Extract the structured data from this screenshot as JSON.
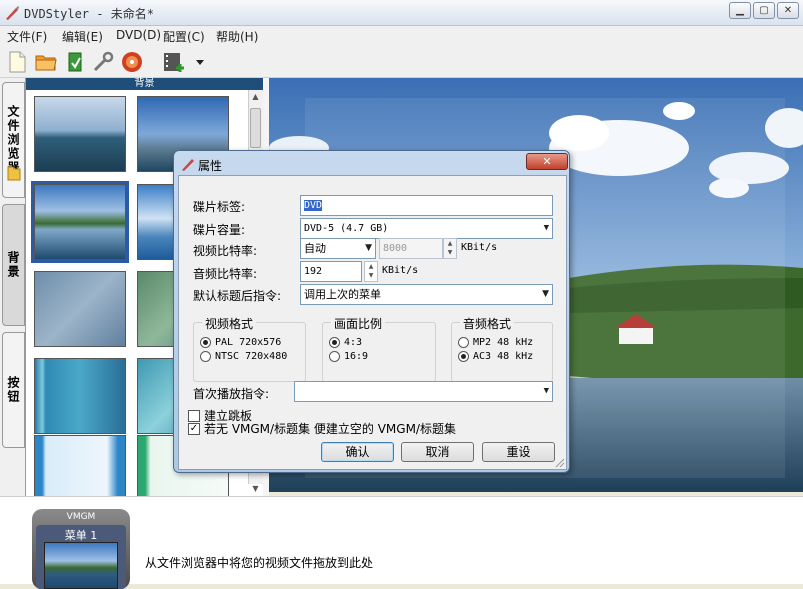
{
  "window": {
    "title": "DVDStyler - 未命名*"
  },
  "menu": {
    "items": [
      "文件(F)",
      "编辑(E)",
      "DVD(D)",
      "配置(C)",
      "帮助(H)"
    ]
  },
  "toolbar": {
    "icons": [
      "new-icon",
      "open-icon",
      "save-icon",
      "settings-icon",
      "burn-icon",
      "add-file-icon",
      "dropdown-icon"
    ]
  },
  "sidebar": {
    "tabs": [
      "文件浏览器",
      "背景",
      "按钮"
    ],
    "active_tab": "背景"
  },
  "browser": {
    "header": "背景"
  },
  "menus_panel": {
    "vmgm_label": "VMGM",
    "menu_label": "菜单 1"
  },
  "bottom": {
    "hint": "从文件浏览器中将您的视频文件拖放到此处"
  },
  "dialog": {
    "title": "属性",
    "close_label": "✕",
    "disc_label": {
      "label": "碟片标签:",
      "value": "DVD"
    },
    "disc_capacity": {
      "label": "碟片容量:",
      "value": "DVD-5 (4.7 GB)"
    },
    "video_bitrate": {
      "label": "视频比特率:",
      "mode": "自动",
      "value": "8000",
      "unit": "KBit/s"
    },
    "audio_bitrate": {
      "label": "音频比特率:",
      "value": "192",
      "unit": "KBit/s"
    },
    "post_command": {
      "label": "默认标题后指令:",
      "value": "调用上次的菜单"
    },
    "video_format": {
      "title": "视频格式",
      "options": [
        "PAL 720x576",
        "NTSC 720x480"
      ],
      "selected": 0
    },
    "aspect_ratio": {
      "title": "画面比例",
      "options": [
        "4:3",
        "16:9"
      ],
      "selected": 0
    },
    "audio_format": {
      "title": "音频格式",
      "options": [
        "MP2 48 kHz",
        "AC3 48 kHz"
      ],
      "selected": 1
    },
    "first_play": {
      "label": "首次播放指令:",
      "value": ""
    },
    "create_jumppad": {
      "label": "建立跳板",
      "checked": false
    },
    "create_vmgm": {
      "label": "若无 VMGM/标题集 便建立空的 VMGM/标题集",
      "checked": true
    },
    "ok_label": "确认",
    "cancel_label": "取消",
    "reset_label": "重设"
  }
}
